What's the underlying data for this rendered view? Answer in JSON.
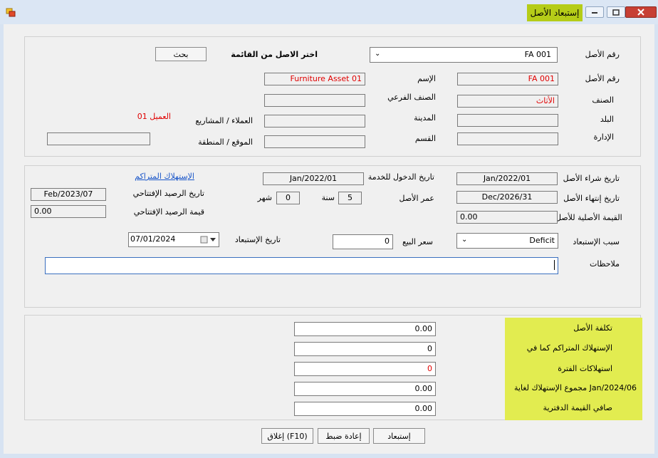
{
  "window": {
    "title": "إستبعاد الأصل"
  },
  "select_section": {
    "asset_no_label": "رقم الأصل",
    "asset_no_value": "FA 001",
    "choose_label": "اختر الاصل من القائمة",
    "search_button": "بحث"
  },
  "info": {
    "asset_no_label": "رقم الأصل",
    "asset_no_value": "FA 001",
    "name_label": "الإسم",
    "name_value": "Furniture Asset 01",
    "category_label": "الصنف",
    "category_value": "الأثاث",
    "subcategory_label": "الصنف الفرعي",
    "subcategory_value": "",
    "country_label": "البلد",
    "country_value": "",
    "city_label": "المدينة",
    "city_value": "",
    "customers_label": "العملاء / المشاريع",
    "customers_value": "",
    "customer_name": "العميل 01",
    "department_label": "الإدارة",
    "department_value": "",
    "section_label": "القسم",
    "section_value": "",
    "location_label": "الموقع / المنطقة",
    "location_value": ""
  },
  "dates": {
    "purchase_date_label": "تاريخ شراء الأصل",
    "purchase_date_value": "Jan/2022/01",
    "service_date_label": "تاريخ الدخول للخدمة",
    "service_date_value": "Jan/2022/01",
    "accum_dep_link": "الإستهلاك المتراكم",
    "end_date_label": "تاريخ إنتهاء الأصل",
    "end_date_value": "Dec/2026/31",
    "age_label": "عمر الأصل",
    "years_value": "5",
    "years_label": "سنة",
    "months_value": "0",
    "months_label": "شهر",
    "opening_date_label": "تاريخ الرصيد الإفتتاحي",
    "opening_date_value": "Feb/2023/07",
    "original_value_label": "القيمة الأصلية للأصل",
    "original_value": "0.00",
    "opening_value_label": "قيمة الرصيد الإفتتاحي",
    "opening_value": "0.00",
    "reason_label": "سبب الإستبعاد",
    "reason_value": "Deficit",
    "sale_price_label": "سعر البيع",
    "sale_price_value": "0",
    "disposal_date_label": "تاريخ الإستبعاد",
    "disposal_date_value": "07/01/2024",
    "notes_label": "ملاحظات",
    "notes_value": ""
  },
  "summary": {
    "cost_label": "تكلفة الأصل",
    "cost_value": "0.00",
    "accum_label": "الإستهلاك المتراكم كما في",
    "accum_value": "0",
    "period_label": "استهلاكات الفترة",
    "period_value": "0",
    "total_label": "مجموع الإستهلاك لغاية Jan/2024/06",
    "total_value": "0.00",
    "net_label": "صافي القيمة الدفترية",
    "net_value": "0.00"
  },
  "buttons": {
    "dispose": "إستبعاد",
    "reset": "إعادة ضبط",
    "close": "إغلاق (F10)"
  },
  "colors": {
    "title_highlight": "#b5cc18",
    "summary_bg": "#e2ec50",
    "red_text": "#e00000",
    "link": "#1a56c9",
    "close_button": "#c73f34"
  }
}
